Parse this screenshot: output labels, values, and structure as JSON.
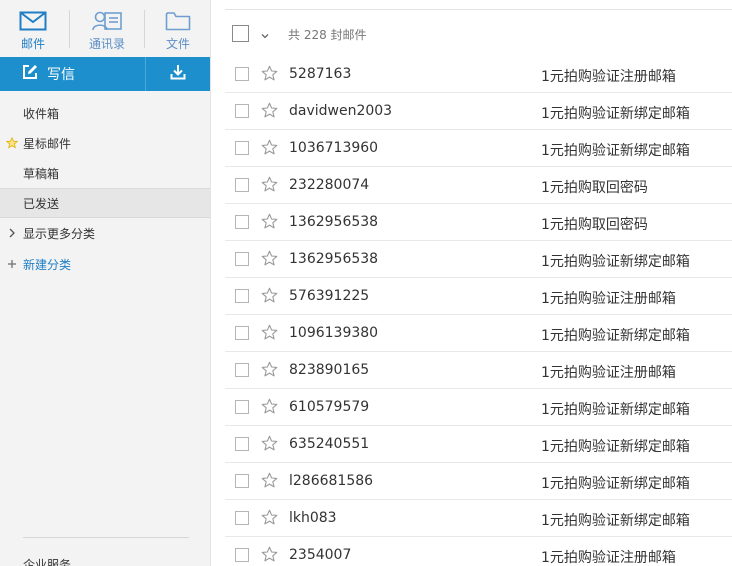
{
  "nav": {
    "mail_label": "邮件",
    "contacts_label": "通讯录",
    "files_label": "文件"
  },
  "compose": {
    "label": "写信"
  },
  "folders": [
    {
      "label": "收件箱"
    },
    {
      "label": "星标邮件"
    },
    {
      "label": "草稿箱"
    },
    {
      "label": "已发送"
    },
    {
      "label": "显示更多分类"
    },
    {
      "label": "新建分类"
    }
  ],
  "sidebar_bottom": "企业服务",
  "toolbar": {
    "count_text": "共 228 封邮件"
  },
  "mails": [
    {
      "sender": "5287163",
      "subject": "1元拍购验证注册邮箱"
    },
    {
      "sender": "davidwen2003",
      "subject": "1元拍购验证新绑定邮箱"
    },
    {
      "sender": "1036713960",
      "subject": "1元拍购验证新绑定邮箱"
    },
    {
      "sender": "232280074",
      "subject": "1元拍购取回密码"
    },
    {
      "sender": "1362956538",
      "subject": "1元拍购取回密码"
    },
    {
      "sender": "1362956538",
      "subject": "1元拍购验证新绑定邮箱"
    },
    {
      "sender": "576391225",
      "subject": "1元拍购验证注册邮箱"
    },
    {
      "sender": "1096139380",
      "subject": "1元拍购验证新绑定邮箱"
    },
    {
      "sender": "823890165",
      "subject": "1元拍购验证注册邮箱"
    },
    {
      "sender": "610579579",
      "subject": "1元拍购验证新绑定邮箱"
    },
    {
      "sender": "635240551",
      "subject": "1元拍购验证新绑定邮箱"
    },
    {
      "sender": "l286681586",
      "subject": "1元拍购验证新绑定邮箱"
    },
    {
      "sender": "lkh083",
      "subject": "1元拍购验证新绑定邮箱"
    },
    {
      "sender": "2354007",
      "subject": "1元拍购验证注册邮箱"
    }
  ],
  "colors": {
    "accent": "#1d8fcd",
    "nav_label": "#5b8fc6",
    "sidebar_bg": "#f3f3f3",
    "star": "#f5c400"
  },
  "icons": {
    "mail_nav": "envelope-icon",
    "contacts_nav": "contact-card-icon",
    "files_nav": "folder-icon",
    "compose": "edit-icon",
    "receive": "download-icon",
    "starred": "star-icon",
    "expand": "chevron-right-icon",
    "add": "plus-icon",
    "select_menu": "chevron-down-icon",
    "row_star": "star-outline-icon"
  }
}
